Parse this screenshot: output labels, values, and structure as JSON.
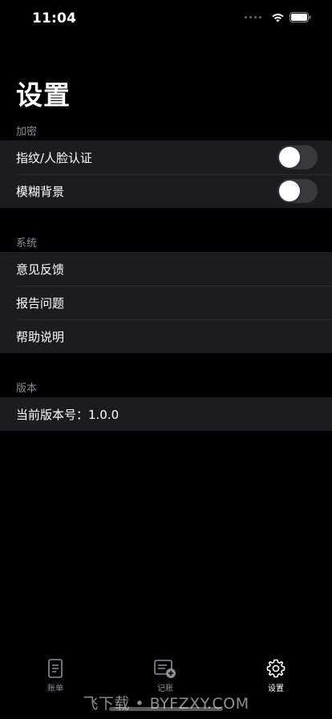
{
  "status_bar": {
    "time": "11:04",
    "icons": [
      "signal-dots-icon",
      "wifi-icon",
      "battery-icon"
    ]
  },
  "page": {
    "title": "设置"
  },
  "sections": [
    {
      "header": "加密",
      "rows": [
        {
          "label": "指纹/人脸认证",
          "toggle_on": false
        },
        {
          "label": "模糊背景",
          "toggle_on": false
        }
      ]
    },
    {
      "header": "系统",
      "rows": [
        {
          "label": "意见反馈"
        },
        {
          "label": "报告问题"
        },
        {
          "label": "帮助说明"
        }
      ]
    },
    {
      "header": "版本",
      "rows": [
        {
          "label": "当前版本号：1.0.0"
        }
      ]
    }
  ],
  "tab_bar": {
    "tabs": [
      {
        "label": "账单",
        "icon": "document-icon",
        "active": false
      },
      {
        "label": "记账",
        "icon": "add-record-icon",
        "active": false
      },
      {
        "label": "设置",
        "icon": "gear-icon",
        "active": true
      }
    ]
  },
  "watermark": "飞下载 • BYFZXY.COM",
  "colors": {
    "background": "#000000",
    "group_background": "#1c1c1e",
    "section_header": "#8e8e93",
    "toggle_off": "#39393d",
    "tab_inactive": "#8e8e93"
  }
}
